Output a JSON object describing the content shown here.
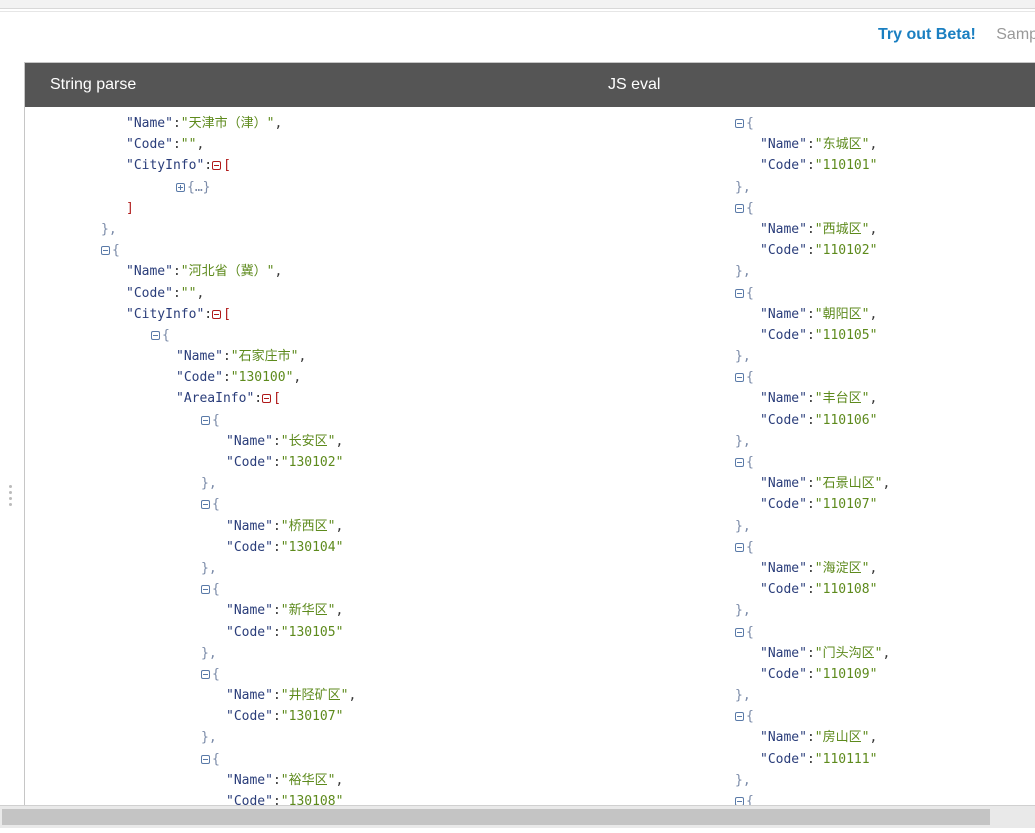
{
  "header": {
    "beta_link": "Try out Beta!",
    "sample_link": "Sampl"
  },
  "columns": {
    "left_title": "String parse",
    "right_title": "JS eval"
  },
  "left_lines": [
    {
      "indent": 3,
      "tokens": [
        {
          "t": "k",
          "v": "\"Name\""
        },
        {
          "t": "p",
          "v": ":"
        },
        {
          "t": "s",
          "v": "\"天津市（津）\""
        },
        {
          "t": "p",
          "v": ","
        }
      ]
    },
    {
      "indent": 3,
      "tokens": [
        {
          "t": "k",
          "v": "\"Code\""
        },
        {
          "t": "p",
          "v": ":"
        },
        {
          "t": "s",
          "v": "\"\""
        },
        {
          "t": "p",
          "v": ","
        }
      ]
    },
    {
      "indent": 3,
      "tokens": [
        {
          "t": "k",
          "v": "\"CityInfo\""
        },
        {
          "t": "p",
          "v": ":"
        },
        {
          "t": "toggle-minus-red"
        },
        {
          "t": "b",
          "v": "["
        }
      ]
    },
    {
      "indent": 5,
      "tokens": [
        {
          "t": "toggle-plus"
        },
        {
          "t": "g",
          "v": "{…}"
        }
      ]
    },
    {
      "indent": 3,
      "tokens": [
        {
          "t": "b",
          "v": "]"
        }
      ]
    },
    {
      "indent": 2,
      "tokens": [
        {
          "t": "g",
          "v": "},"
        }
      ]
    },
    {
      "indent": 2,
      "tokens": [
        {
          "t": "toggle-minus-grey"
        },
        {
          "t": "g",
          "v": "{"
        }
      ]
    },
    {
      "indent": 3,
      "tokens": [
        {
          "t": "k",
          "v": "\"Name\""
        },
        {
          "t": "p",
          "v": ":"
        },
        {
          "t": "s",
          "v": "\"河北省（冀）\""
        },
        {
          "t": "p",
          "v": ","
        }
      ]
    },
    {
      "indent": 3,
      "tokens": [
        {
          "t": "k",
          "v": "\"Code\""
        },
        {
          "t": "p",
          "v": ":"
        },
        {
          "t": "s",
          "v": "\"\""
        },
        {
          "t": "p",
          "v": ","
        }
      ]
    },
    {
      "indent": 3,
      "tokens": [
        {
          "t": "k",
          "v": "\"CityInfo\""
        },
        {
          "t": "p",
          "v": ":"
        },
        {
          "t": "toggle-minus-red"
        },
        {
          "t": "b",
          "v": "["
        }
      ]
    },
    {
      "indent": 4,
      "tokens": [
        {
          "t": "toggle-minus-grey"
        },
        {
          "t": "g",
          "v": "{"
        }
      ]
    },
    {
      "indent": 5,
      "tokens": [
        {
          "t": "k",
          "v": "\"Name\""
        },
        {
          "t": "p",
          "v": ":"
        },
        {
          "t": "s",
          "v": "\"石家庄市\""
        },
        {
          "t": "p",
          "v": ","
        }
      ]
    },
    {
      "indent": 5,
      "tokens": [
        {
          "t": "k",
          "v": "\"Code\""
        },
        {
          "t": "p",
          "v": ":"
        },
        {
          "t": "s",
          "v": "\"130100\""
        },
        {
          "t": "p",
          "v": ","
        }
      ]
    },
    {
      "indent": 5,
      "tokens": [
        {
          "t": "k",
          "v": "\"AreaInfo\""
        },
        {
          "t": "p",
          "v": ":"
        },
        {
          "t": "toggle-minus-red"
        },
        {
          "t": "b",
          "v": "["
        }
      ]
    },
    {
      "indent": 6,
      "tokens": [
        {
          "t": "toggle-minus-grey"
        },
        {
          "t": "g",
          "v": "{"
        }
      ]
    },
    {
      "indent": 7,
      "tokens": [
        {
          "t": "k",
          "v": "\"Name\""
        },
        {
          "t": "p",
          "v": ":"
        },
        {
          "t": "s",
          "v": "\"长安区\""
        },
        {
          "t": "p",
          "v": ","
        }
      ]
    },
    {
      "indent": 7,
      "tokens": [
        {
          "t": "k",
          "v": "\"Code\""
        },
        {
          "t": "p",
          "v": ":"
        },
        {
          "t": "s",
          "v": "\"130102\""
        }
      ]
    },
    {
      "indent": 6,
      "tokens": [
        {
          "t": "g",
          "v": "},"
        }
      ]
    },
    {
      "indent": 6,
      "tokens": [
        {
          "t": "toggle-minus-grey"
        },
        {
          "t": "g",
          "v": "{"
        }
      ]
    },
    {
      "indent": 7,
      "tokens": [
        {
          "t": "k",
          "v": "\"Name\""
        },
        {
          "t": "p",
          "v": ":"
        },
        {
          "t": "s",
          "v": "\"桥西区\""
        },
        {
          "t": "p",
          "v": ","
        }
      ]
    },
    {
      "indent": 7,
      "tokens": [
        {
          "t": "k",
          "v": "\"Code\""
        },
        {
          "t": "p",
          "v": ":"
        },
        {
          "t": "s",
          "v": "\"130104\""
        }
      ]
    },
    {
      "indent": 6,
      "tokens": [
        {
          "t": "g",
          "v": "},"
        }
      ]
    },
    {
      "indent": 6,
      "tokens": [
        {
          "t": "toggle-minus-grey"
        },
        {
          "t": "g",
          "v": "{"
        }
      ]
    },
    {
      "indent": 7,
      "tokens": [
        {
          "t": "k",
          "v": "\"Name\""
        },
        {
          "t": "p",
          "v": ":"
        },
        {
          "t": "s",
          "v": "\"新华区\""
        },
        {
          "t": "p",
          "v": ","
        }
      ]
    },
    {
      "indent": 7,
      "tokens": [
        {
          "t": "k",
          "v": "\"Code\""
        },
        {
          "t": "p",
          "v": ":"
        },
        {
          "t": "s",
          "v": "\"130105\""
        }
      ]
    },
    {
      "indent": 6,
      "tokens": [
        {
          "t": "g",
          "v": "},"
        }
      ]
    },
    {
      "indent": 6,
      "tokens": [
        {
          "t": "toggle-minus-grey"
        },
        {
          "t": "g",
          "v": "{"
        }
      ]
    },
    {
      "indent": 7,
      "tokens": [
        {
          "t": "k",
          "v": "\"Name\""
        },
        {
          "t": "p",
          "v": ":"
        },
        {
          "t": "s",
          "v": "\"井陉矿区\""
        },
        {
          "t": "p",
          "v": ","
        }
      ]
    },
    {
      "indent": 7,
      "tokens": [
        {
          "t": "k",
          "v": "\"Code\""
        },
        {
          "t": "p",
          "v": ":"
        },
        {
          "t": "s",
          "v": "\"130107\""
        }
      ]
    },
    {
      "indent": 6,
      "tokens": [
        {
          "t": "g",
          "v": "},"
        }
      ]
    },
    {
      "indent": 6,
      "tokens": [
        {
          "t": "toggle-minus-grey"
        },
        {
          "t": "g",
          "v": "{"
        }
      ]
    },
    {
      "indent": 7,
      "tokens": [
        {
          "t": "k",
          "v": "\"Name\""
        },
        {
          "t": "p",
          "v": ":"
        },
        {
          "t": "s",
          "v": "\"裕华区\""
        },
        {
          "t": "p",
          "v": ","
        }
      ]
    },
    {
      "indent": 7,
      "tokens": [
        {
          "t": "k",
          "v": "\"Code\""
        },
        {
          "t": "p",
          "v": ":"
        },
        {
          "t": "s",
          "v": "\"130108\""
        }
      ]
    }
  ],
  "right_lines": [
    {
      "indent": 0,
      "tokens": [
        {
          "t": "toggle-minus-grey"
        },
        {
          "t": "g",
          "v": "{"
        }
      ]
    },
    {
      "indent": 1,
      "tokens": [
        {
          "t": "k",
          "v": "\"Name\""
        },
        {
          "t": "p",
          "v": ":"
        },
        {
          "t": "s",
          "v": "\"东城区\""
        },
        {
          "t": "p",
          "v": ","
        }
      ]
    },
    {
      "indent": 1,
      "tokens": [
        {
          "t": "k",
          "v": "\"Code\""
        },
        {
          "t": "p",
          "v": ":"
        },
        {
          "t": "s",
          "v": "\"110101\""
        }
      ]
    },
    {
      "indent": 0,
      "tokens": [
        {
          "t": "g",
          "v": "},"
        }
      ]
    },
    {
      "indent": 0,
      "tokens": [
        {
          "t": "toggle-minus-grey"
        },
        {
          "t": "g",
          "v": "{"
        }
      ]
    },
    {
      "indent": 1,
      "tokens": [
        {
          "t": "k",
          "v": "\"Name\""
        },
        {
          "t": "p",
          "v": ":"
        },
        {
          "t": "s",
          "v": "\"西城区\""
        },
        {
          "t": "p",
          "v": ","
        }
      ]
    },
    {
      "indent": 1,
      "tokens": [
        {
          "t": "k",
          "v": "\"Code\""
        },
        {
          "t": "p",
          "v": ":"
        },
        {
          "t": "s",
          "v": "\"110102\""
        }
      ]
    },
    {
      "indent": 0,
      "tokens": [
        {
          "t": "g",
          "v": "},"
        }
      ]
    },
    {
      "indent": 0,
      "tokens": [
        {
          "t": "toggle-minus-grey"
        },
        {
          "t": "g",
          "v": "{"
        }
      ]
    },
    {
      "indent": 1,
      "tokens": [
        {
          "t": "k",
          "v": "\"Name\""
        },
        {
          "t": "p",
          "v": ":"
        },
        {
          "t": "s",
          "v": "\"朝阳区\""
        },
        {
          "t": "p",
          "v": ","
        }
      ]
    },
    {
      "indent": 1,
      "tokens": [
        {
          "t": "k",
          "v": "\"Code\""
        },
        {
          "t": "p",
          "v": ":"
        },
        {
          "t": "s",
          "v": "\"110105\""
        }
      ]
    },
    {
      "indent": 0,
      "tokens": [
        {
          "t": "g",
          "v": "},"
        }
      ]
    },
    {
      "indent": 0,
      "tokens": [
        {
          "t": "toggle-minus-grey"
        },
        {
          "t": "g",
          "v": "{"
        }
      ]
    },
    {
      "indent": 1,
      "tokens": [
        {
          "t": "k",
          "v": "\"Name\""
        },
        {
          "t": "p",
          "v": ":"
        },
        {
          "t": "s",
          "v": "\"丰台区\""
        },
        {
          "t": "p",
          "v": ","
        }
      ]
    },
    {
      "indent": 1,
      "tokens": [
        {
          "t": "k",
          "v": "\"Code\""
        },
        {
          "t": "p",
          "v": ":"
        },
        {
          "t": "s",
          "v": "\"110106\""
        }
      ]
    },
    {
      "indent": 0,
      "tokens": [
        {
          "t": "g",
          "v": "},"
        }
      ]
    },
    {
      "indent": 0,
      "tokens": [
        {
          "t": "toggle-minus-grey"
        },
        {
          "t": "g",
          "v": "{"
        }
      ]
    },
    {
      "indent": 1,
      "tokens": [
        {
          "t": "k",
          "v": "\"Name\""
        },
        {
          "t": "p",
          "v": ":"
        },
        {
          "t": "s",
          "v": "\"石景山区\""
        },
        {
          "t": "p",
          "v": ","
        }
      ]
    },
    {
      "indent": 1,
      "tokens": [
        {
          "t": "k",
          "v": "\"Code\""
        },
        {
          "t": "p",
          "v": ":"
        },
        {
          "t": "s",
          "v": "\"110107\""
        }
      ]
    },
    {
      "indent": 0,
      "tokens": [
        {
          "t": "g",
          "v": "},"
        }
      ]
    },
    {
      "indent": 0,
      "tokens": [
        {
          "t": "toggle-minus-grey"
        },
        {
          "t": "g",
          "v": "{"
        }
      ]
    },
    {
      "indent": 1,
      "tokens": [
        {
          "t": "k",
          "v": "\"Name\""
        },
        {
          "t": "p",
          "v": ":"
        },
        {
          "t": "s",
          "v": "\"海淀区\""
        },
        {
          "t": "p",
          "v": ","
        }
      ]
    },
    {
      "indent": 1,
      "tokens": [
        {
          "t": "k",
          "v": "\"Code\""
        },
        {
          "t": "p",
          "v": ":"
        },
        {
          "t": "s",
          "v": "\"110108\""
        }
      ]
    },
    {
      "indent": 0,
      "tokens": [
        {
          "t": "g",
          "v": "},"
        }
      ]
    },
    {
      "indent": 0,
      "tokens": [
        {
          "t": "toggle-minus-grey"
        },
        {
          "t": "g",
          "v": "{"
        }
      ]
    },
    {
      "indent": 1,
      "tokens": [
        {
          "t": "k",
          "v": "\"Name\""
        },
        {
          "t": "p",
          "v": ":"
        },
        {
          "t": "s",
          "v": "\"门头沟区\""
        },
        {
          "t": "p",
          "v": ","
        }
      ]
    },
    {
      "indent": 1,
      "tokens": [
        {
          "t": "k",
          "v": "\"Code\""
        },
        {
          "t": "p",
          "v": ":"
        },
        {
          "t": "s",
          "v": "\"110109\""
        }
      ]
    },
    {
      "indent": 0,
      "tokens": [
        {
          "t": "g",
          "v": "},"
        }
      ]
    },
    {
      "indent": 0,
      "tokens": [
        {
          "t": "toggle-minus-grey"
        },
        {
          "t": "g",
          "v": "{"
        }
      ]
    },
    {
      "indent": 1,
      "tokens": [
        {
          "t": "k",
          "v": "\"Name\""
        },
        {
          "t": "p",
          "v": ":"
        },
        {
          "t": "s",
          "v": "\"房山区\""
        },
        {
          "t": "p",
          "v": ","
        }
      ]
    },
    {
      "indent": 1,
      "tokens": [
        {
          "t": "k",
          "v": "\"Code\""
        },
        {
          "t": "p",
          "v": ":"
        },
        {
          "t": "s",
          "v": "\"110111\""
        }
      ]
    },
    {
      "indent": 0,
      "tokens": [
        {
          "t": "g",
          "v": "},"
        }
      ]
    },
    {
      "indent": 0,
      "tokens": [
        {
          "t": "toggle-minus-grey"
        },
        {
          "t": "g",
          "v": "{"
        }
      ]
    }
  ]
}
